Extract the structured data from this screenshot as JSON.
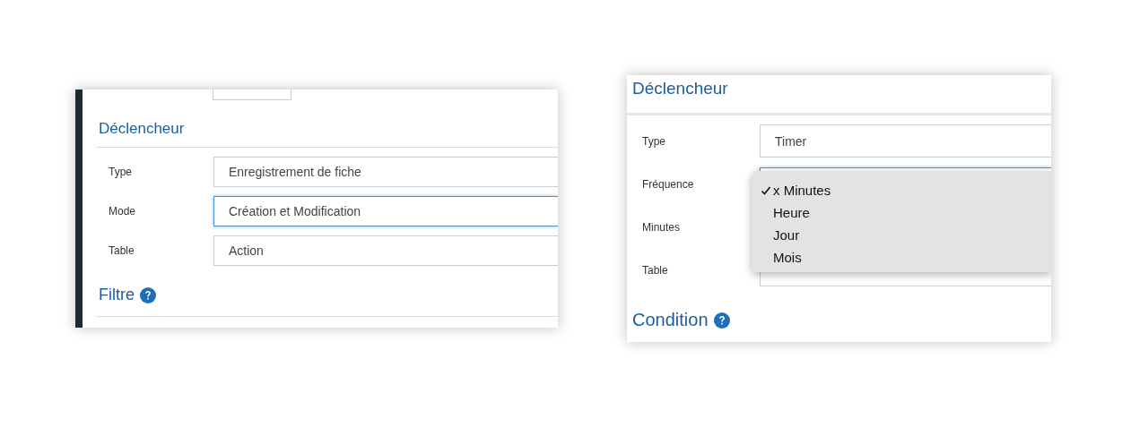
{
  "panels": [
    {
      "accent_bar": true,
      "top_stub": true,
      "heading": "Déclencheur",
      "fields": [
        {
          "label": "Type",
          "value": "Enregistrement de fiche",
          "focused": false
        },
        {
          "label": "Mode",
          "value": "Création et Modification",
          "focused": true
        },
        {
          "label": "Table",
          "value": "Action",
          "focused": false
        }
      ],
      "next_heading": {
        "text": "Filtre",
        "help": true
      }
    },
    {
      "accent_bar": false,
      "top_stub": false,
      "heading": "Déclencheur",
      "fields": [
        {
          "label": "Type",
          "value": "Timer",
          "focused": false
        },
        {
          "label": "Fréquence",
          "focused": true,
          "dropdown": [
            {
              "label": "x Minutes",
              "selected": true
            },
            {
              "label": "Heure",
              "selected": false
            },
            {
              "label": "Jour",
              "selected": false
            },
            {
              "label": "Mois",
              "selected": false
            }
          ]
        },
        {
          "label": "Minutes"
        },
        {
          "label": "Table",
          "focused": false
        }
      ],
      "next_heading": {
        "text": "Condition",
        "help": true
      }
    }
  ]
}
